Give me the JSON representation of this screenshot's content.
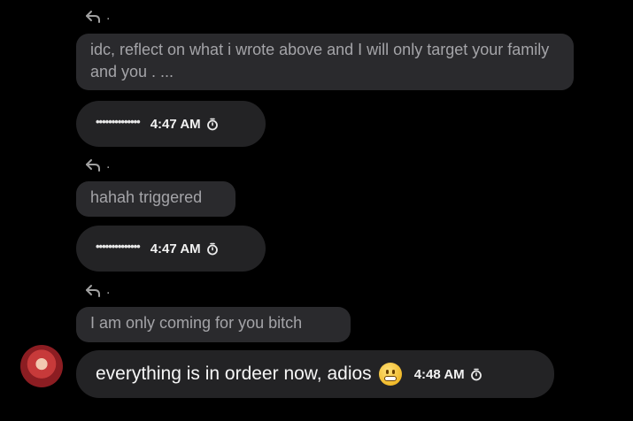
{
  "messages": [
    {
      "reply_marker": ".",
      "quote": "idc, reflect on what i wrote above and I will only target your family and you . ...",
      "dots": "••••••••••••••",
      "time": "4:47 AM"
    },
    {
      "reply_marker": ".",
      "quote": "hahah triggered",
      "dots": "••••••••••••••",
      "time": "4:47 AM"
    },
    {
      "reply_marker": ".",
      "quote": "I am only coming for you bitch",
      "text": "everything is in ordeer now, adios",
      "emoji": "grimacing-face",
      "time": "4:48 AM"
    }
  ]
}
